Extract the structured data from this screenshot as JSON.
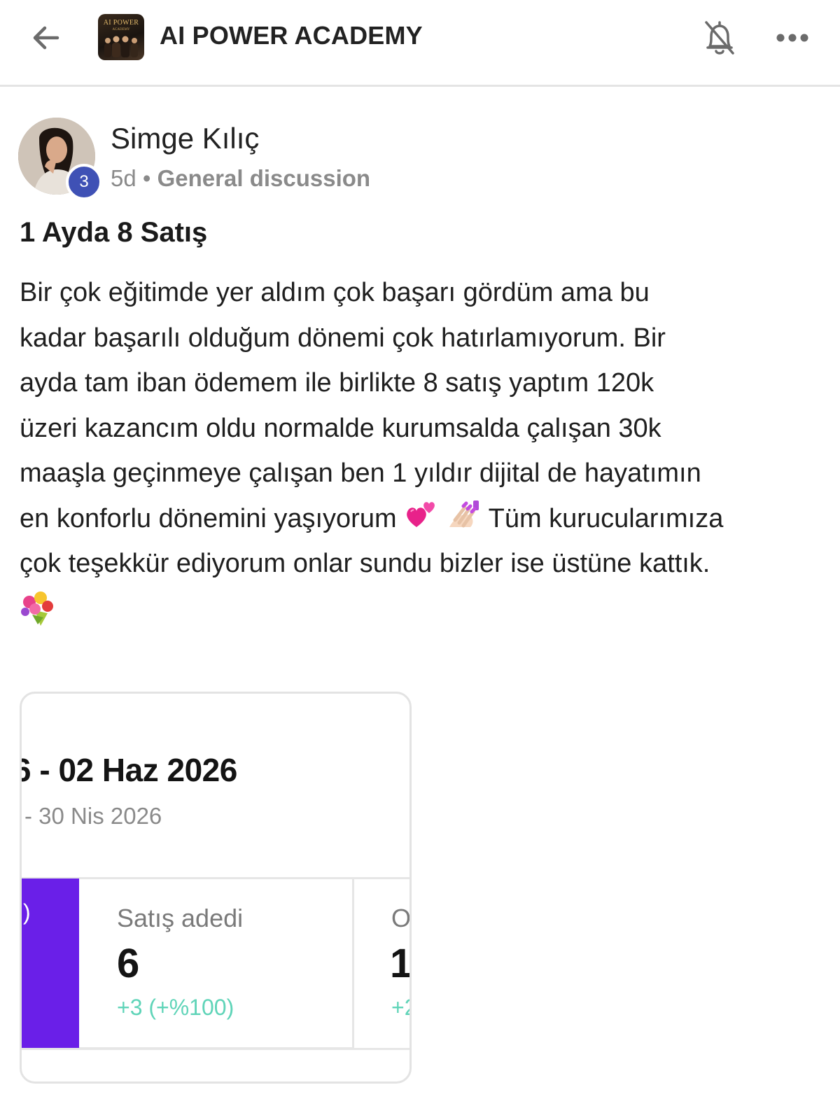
{
  "header": {
    "group_name": "AI POWER ACADEMY",
    "logo_text": "AI POWER",
    "logo_subtext": "ACADEMY",
    "icons": {
      "back": "arrow-left-icon",
      "notifications": "bell-off-icon",
      "more": "more-horizontal-icon"
    }
  },
  "post": {
    "author": {
      "name": "Simge Kılıç",
      "level": "3"
    },
    "time_ago": "5d",
    "separator": "•",
    "category": "General discussion",
    "title": "1 Ayda 8 Satış",
    "body_lines": [
      "Bir çok eğitimde yer aldım çok başarı gördüm ama bu",
      "kadar başarılı olduğum dönemi çok hatırlamıyorum. Bir",
      "ayda tam iban ödemem ile birlikte 8 satış yaptım 120k",
      "üzeri kazancım oldu normalde kurumsalda çalışan 30k",
      "maaşla geçinmeye çalışan ben 1 yıldır dijital de hayatımın"
    ],
    "body_line6_start": "en konforlu dönemini yaşıyorum",
    "body_line6_end": "Tüm kurucularımıza",
    "body_line7": "çok teşekkür ediyorum onlar sundu bizler ise üstüne kattık.",
    "emojis": [
      "two-hearts-emoji",
      "nail-polish-emoji",
      "bouquet-emoji"
    ]
  },
  "attachment": {
    "date_range": "6 - 02 Haz 2026",
    "compare_range": "- 30 Nis 2026",
    "metric": {
      "label": "Satış adedi",
      "value": "6",
      "change": "+3 (+%100)"
    },
    "next_metric_partial": {
      "label": "O",
      "value": "1",
      "change": "+2"
    },
    "colors": {
      "accent_purple": "#6a1fe8",
      "change_green": "#5fd4b8"
    }
  },
  "colors": {
    "level_badge": "#3f51b5",
    "meta_gray": "#8a8a8a"
  }
}
